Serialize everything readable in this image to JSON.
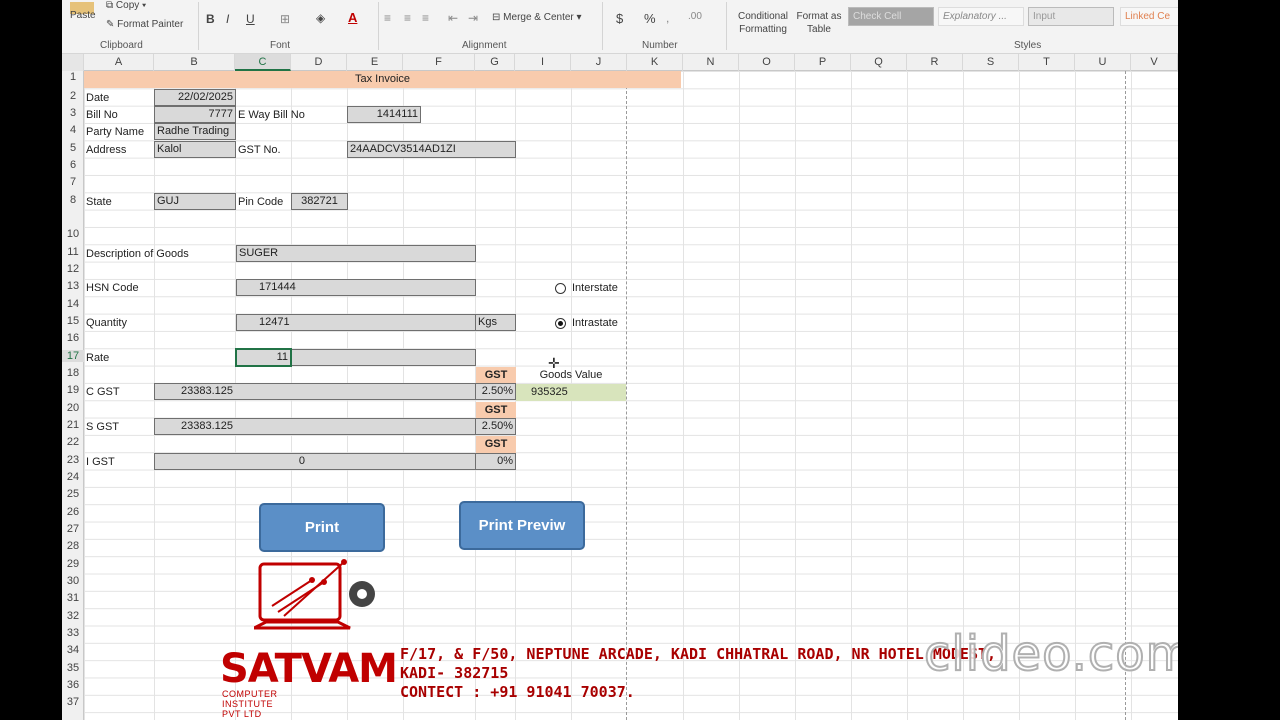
{
  "ribbon": {
    "clipboard": {
      "paste": "Paste",
      "copy": "Copy",
      "format_painter": "Format Painter",
      "label": "Clipboard"
    },
    "font": {
      "bold": "B",
      "italic": "I",
      "underline": "U",
      "label": "Font"
    },
    "alignment": {
      "merge_center": "Merge & Center",
      "label": "Alignment"
    },
    "number": {
      "currency": "$",
      "percent": "%",
      "label": "Number"
    },
    "styles": {
      "conditional_formatting": "Conditional Formatting",
      "format_as_table": "Format as Table",
      "check_cell": "Check Cell",
      "explanatory": "Explanatory ...",
      "input": "Input",
      "linked_cell": "Linked Ce",
      "label": "Styles"
    }
  },
  "columns": [
    "A",
    "B",
    "C",
    "D",
    "E",
    "F",
    "G",
    "I",
    "J",
    "K",
    "N",
    "O",
    "P",
    "Q",
    "R",
    "S",
    "T",
    "U",
    "V"
  ],
  "rows": [
    "1",
    "2",
    "3",
    "4",
    "5",
    "6",
    "7",
    "8",
    "10",
    "11",
    "12",
    "13",
    "14",
    "15",
    "16",
    "17",
    "18",
    "19",
    "20",
    "21",
    "22",
    "23",
    "24",
    "25",
    "26",
    "27",
    "28",
    "29",
    "30",
    "31",
    "32",
    "33",
    "34",
    "35",
    "36",
    "37"
  ],
  "invoice": {
    "title": "Tax Invoice",
    "date_label": "Date",
    "date_value": "22/02/2025",
    "bill_label": "Bill No",
    "bill_value": "7777",
    "eway_label": "E Way Bill No",
    "eway_value": "1414111",
    "party_label": "Party Name",
    "party_value": "Radhe Trading",
    "address_label": "Address",
    "address_value": "Kalol",
    "gst_no_label": "GST No.",
    "gst_no_value": "24AADCV3514AD1ZI",
    "state_label": "State",
    "state_value": "GUJ",
    "pin_label": "Pin Code",
    "pin_value": "382721",
    "desc_label": "Description of Goods",
    "desc_value": "SUGER",
    "hsn_label": "HSN Code",
    "hsn_value": "171444",
    "qty_label": "Quantity",
    "qty_value": "12471",
    "qty_unit": "Kgs",
    "rate_label": "Rate",
    "rate_value": "11",
    "interstate": "Interstate",
    "intrastate": "Intrastate",
    "gst_tag": "GST",
    "goods_value_label": "Goods Value",
    "goods_value": "935325",
    "cgst_label": "C GST",
    "cgst_value": "23383.125",
    "cgst_rate": "2.50%",
    "sgst_label": "S GST",
    "sgst_value": "23383.125",
    "sgst_rate": "2.50%",
    "igst_label": "I GST",
    "igst_value": "0",
    "igst_rate": "0%",
    "print": "Print",
    "print_preview": "Print Previw"
  },
  "logo": {
    "name": "SATVAM",
    "subtitle": "COMPUTER INSTITUTE PVT LTD",
    "address_line1": "F/17, & F/50, NEPTUNE ARCADE, KADI CHHATRAL ROAD, NR HOTEL MODEST,",
    "address_line2": "KADI- 382715",
    "contact": "CONTECT : +91 91041 70037."
  },
  "watermark": "clideo.com"
}
